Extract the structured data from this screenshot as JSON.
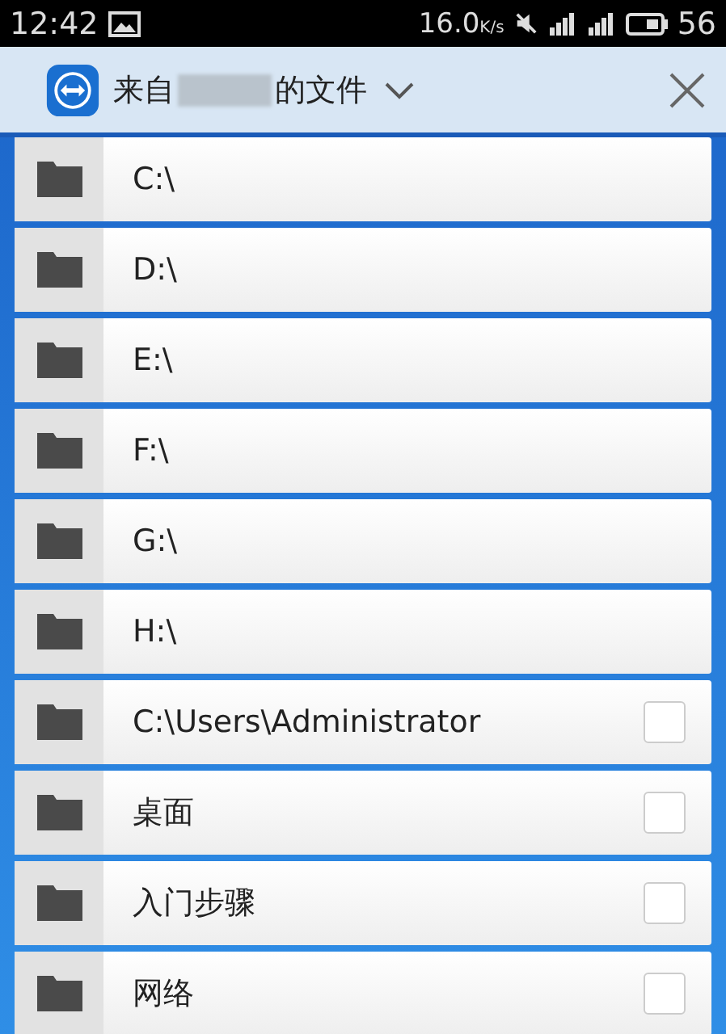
{
  "status_bar": {
    "time": "12:42",
    "speed": "16.0",
    "speed_unit": "K/s",
    "battery": "56"
  },
  "header": {
    "title_before": "来自",
    "title_after": "的文件"
  },
  "items": [
    {
      "kind": "drive",
      "name": "C:\\"
    },
    {
      "kind": "drive",
      "name": "D:\\"
    },
    {
      "kind": "drive",
      "name": "E:\\"
    },
    {
      "kind": "drive",
      "name": "F:\\"
    },
    {
      "kind": "drive",
      "name": "G:\\"
    },
    {
      "kind": "drive",
      "name": "H:\\"
    },
    {
      "kind": "folder",
      "name": "C:\\Users\\Administrator",
      "checked": false
    },
    {
      "kind": "folder",
      "name": "桌面",
      "checked": false
    },
    {
      "kind": "folder",
      "name": "入门步骤",
      "checked": false
    },
    {
      "kind": "folder",
      "name": "网络",
      "checked": false
    }
  ]
}
